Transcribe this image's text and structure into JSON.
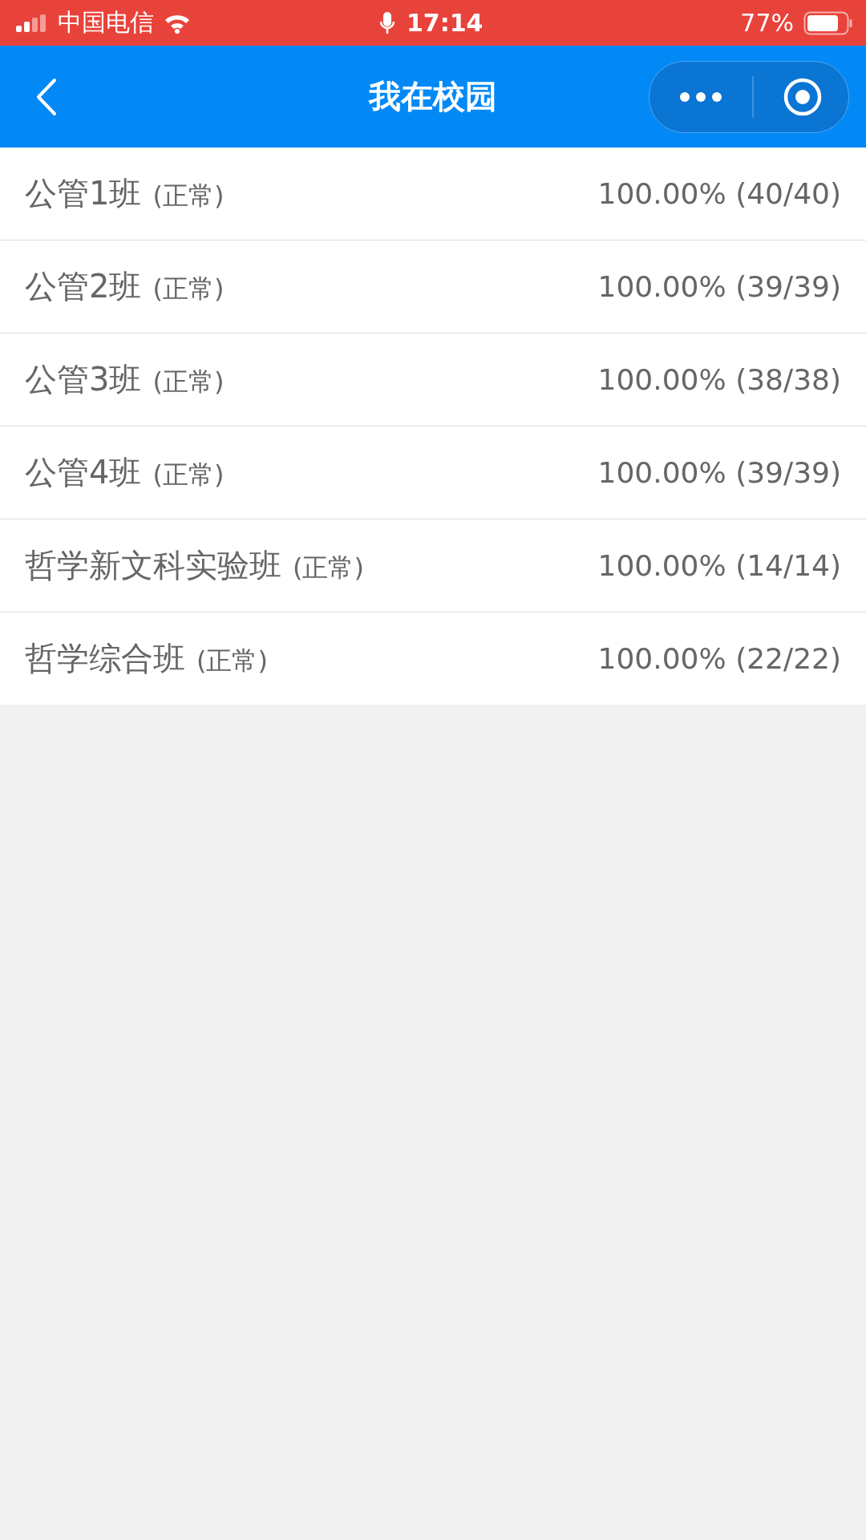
{
  "status_bar": {
    "carrier": "中国电信",
    "time": "17:14",
    "battery": "77%"
  },
  "nav_bar": {
    "title": "我在校园"
  },
  "classes": [
    {
      "name": "公管1班",
      "status": "(正常)",
      "rate": "100.00% (40/40)"
    },
    {
      "name": "公管2班",
      "status": "(正常)",
      "rate": "100.00% (39/39)"
    },
    {
      "name": "公管3班",
      "status": "(正常)",
      "rate": "100.00% (38/38)"
    },
    {
      "name": "公管4班",
      "status": "(正常)",
      "rate": "100.00% (39/39)"
    },
    {
      "name": "哲学新文科实验班",
      "status": "(正常)",
      "rate": "100.00% (14/14)"
    },
    {
      "name": "哲学综合班",
      "status": "(正常)",
      "rate": "100.00% (22/22)"
    }
  ]
}
